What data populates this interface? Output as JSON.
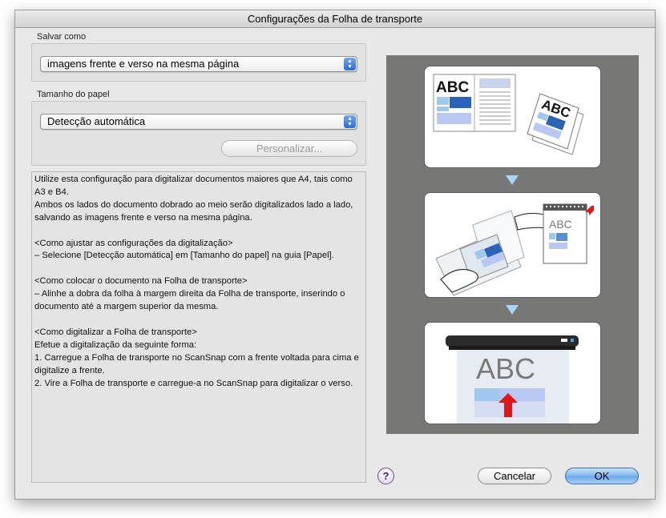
{
  "window": {
    "title": "Configurações da Folha de transporte"
  },
  "save_as": {
    "label": "Salvar como",
    "selected": "imagens frente e verso na mesma página"
  },
  "paper_size": {
    "label": "Tamanho do papel",
    "selected": "Detecção automática",
    "customize_label": "Personalizar..."
  },
  "description": "Utilize esta configuração para digitalizar documentos maiores que A4, tais como A3 e B4.\nAmbos os lados do documento dobrado ao meio serão digitalizados lado a lado, salvando as imagens frente e verso na mesma página.\n\n<Como ajustar as configurações da digitalização>\n– Selecione [Detecção automática] em [Tamanho do papel] na guia [Papel].\n\n<Como colocar o documento na Folha de transporte>\n– Alinhe a dobra da folha à margem direita da Folha de transporte, inserindo o documento até a margem superior da mesma.\n\n<Como digitalizar a Folha de transporte>\nEfetue a digitalização da seguinte forma:\n1. Carregue a Folha de transporte no ScanSnap com a frente voltada para cima e digitalize a frente.\n2. Vire a Folha de transporte e carregue-a no ScanSnap para digitalizar o verso.",
  "illustration": {
    "text_abc": "ABC",
    "colors": {
      "panel_bg": "#777875",
      "accent_blue": "#2a64b8",
      "light_blue": "#a9d4f7",
      "red_arrow": "#e0161b"
    }
  },
  "buttons": {
    "help": "?",
    "cancel": "Cancelar",
    "ok": "OK"
  }
}
